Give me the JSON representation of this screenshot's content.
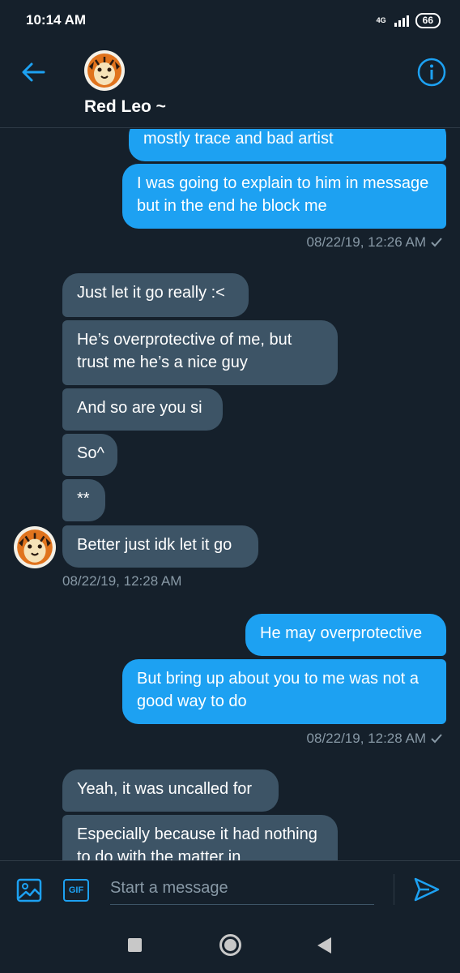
{
  "status_bar": {
    "time": "10:14 AM",
    "network": "4G",
    "battery": "66"
  },
  "header": {
    "contact_name": "Red Leo ~",
    "back_icon": "arrow-left-icon",
    "info_icon": "info-icon",
    "accent": "#1da1f2"
  },
  "messages": [
    {
      "dir": "out",
      "text": "mostly trace and bad artist"
    },
    {
      "dir": "out",
      "text": "I was going to explain to him in message but in the end he block me"
    },
    {
      "dir": "out",
      "stamp": "08/22/19, 12:26 AM"
    },
    {
      "dir": "in",
      "text": "Just let it go really :<"
    },
    {
      "dir": "in",
      "text": "He’s overprotective of me, but trust me he’s a nice guy"
    },
    {
      "dir": "in",
      "text": "And so are you si"
    },
    {
      "dir": "in",
      "text": "So^"
    },
    {
      "dir": "in",
      "text": "**"
    },
    {
      "dir": "in",
      "text": "Better just idk let it go"
    },
    {
      "dir": "in",
      "stamp": "08/22/19, 12:28 AM"
    },
    {
      "dir": "out",
      "text": "He may overprotective"
    },
    {
      "dir": "out",
      "text": "But bring up about you to me was not a good way to do"
    },
    {
      "dir": "out",
      "stamp": "08/22/19, 12:28 AM"
    },
    {
      "dir": "in",
      "text": "Yeah, it was uncalled for"
    },
    {
      "dir": "in",
      "text": "Especially because it had nothing to do with the matter in"
    }
  ],
  "composer": {
    "placeholder": "Start a message",
    "gif_label": "GIF",
    "media_icon": "image-icon",
    "send_icon": "send-icon"
  },
  "colors": {
    "background": "#15202b",
    "outgoing_bubble": "#1da1f2",
    "incoming_bubble": "#3d5466",
    "timestamp": "#8899a6"
  }
}
